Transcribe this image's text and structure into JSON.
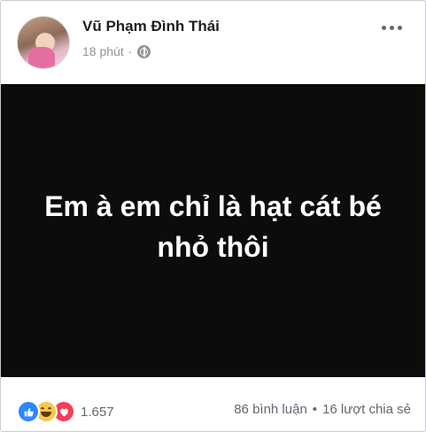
{
  "post": {
    "author": "Vũ Phạm Đình Thái",
    "time": "18 phút",
    "separator": "·",
    "privacy_icon": "globe-icon",
    "more_icon": "more-icon",
    "status_text": "Em à em chỉ là hạt cát bé nhỏ thôi",
    "background_color": "#0c0c0c"
  },
  "footer": {
    "reaction_icons": [
      "like-icon",
      "haha-icon",
      "love-icon"
    ],
    "reaction_count": "1.657",
    "comments": "86 bình luận",
    "separator": "•",
    "shares": "16 lượt chia sẻ"
  },
  "colors": {
    "like": "#2d88ff",
    "haha": "#f7c84a",
    "love": "#f33e58"
  }
}
